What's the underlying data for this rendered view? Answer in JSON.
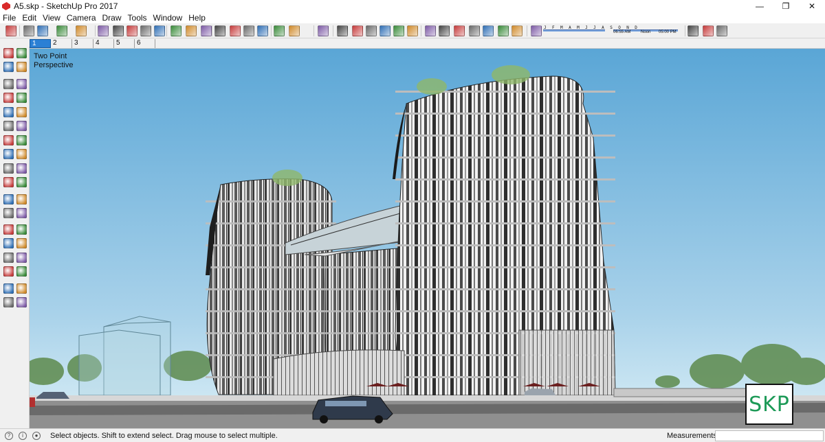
{
  "window": {
    "title": "A5.skp - SketchUp Pro 2017",
    "minimize_glyph": "—",
    "restore_glyph": "❐",
    "close_glyph": "✕"
  },
  "menu": [
    "File",
    "Edit",
    "View",
    "Camera",
    "Draw",
    "Tools",
    "Window",
    "Help"
  ],
  "toolbar": {
    "icons": [
      "select-icon",
      "eraser-icon",
      "pencil-icon",
      "arc-icon",
      "paint-bucket-icon",
      "push-pull-icon",
      "follow-me-icon",
      "move-icon",
      "rotate-icon",
      "scale-icon",
      "tape-measure-icon",
      "text-icon",
      "axes-icon",
      "orbit-icon",
      "pan-icon",
      "zoom-icon",
      "zoom-extents-icon",
      "warehouse-icon",
      "extension-icon",
      "ruby-icon",
      "model-info-icon",
      "component-icon",
      "iso-view-icon",
      "top-view-icon",
      "front-view-icon",
      "right-view-icon",
      "back-view-icon",
      "left-view-icon",
      "xray-icon",
      "wireframe-icon",
      "hidden-line-icon",
      "shaded-icon",
      "textured-icon",
      "monochrome-icon",
      "shadows-toggle-icon",
      "section-plane-icon",
      "fog-icon",
      "geo-location-icon"
    ],
    "shadow_months": "J F M A M J J A S O N D",
    "shadow_time_start": "06:55 AM",
    "shadow_time_noon": "Noon",
    "shadow_time_end": "05:00 PM"
  },
  "scenes": [
    "1",
    "2",
    "3",
    "4",
    "5",
    "6"
  ],
  "active_scene": "1",
  "viewport": {
    "camera_label": "Two Point\nPerspective",
    "badge": "SKP",
    "sky_top": "#5aa6d6",
    "sky_bottom": "#cfe7f2"
  },
  "statusbar": {
    "message": "Select objects. Shift to extend select. Drag mouse to select multiple.",
    "measurements_label": "Measurements",
    "measurements_value": ""
  },
  "colors": {
    "accent": "#2b80d5",
    "brand_red": "#d92a2a",
    "badge_green": "#1d9a57"
  }
}
